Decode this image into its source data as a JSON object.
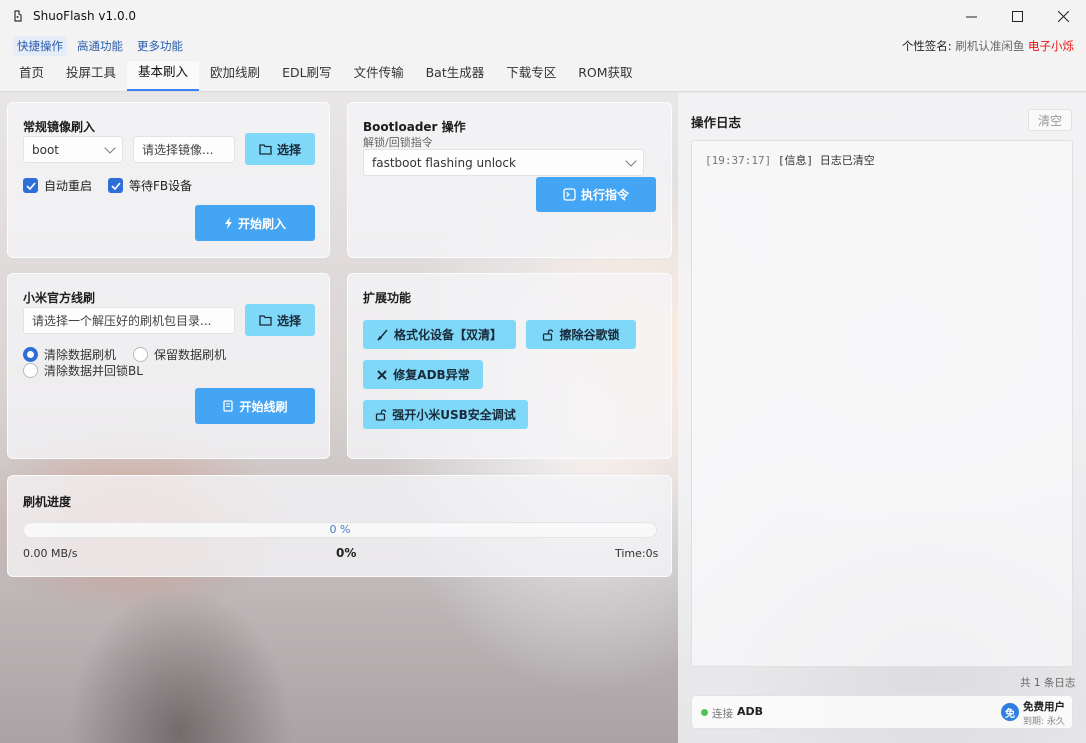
{
  "window": {
    "title": "ShuoFlash v1.0.0"
  },
  "menubar": {
    "items": [
      "快捷操作",
      "高通功能",
      "更多功能"
    ]
  },
  "signature": {
    "label": "个性签名:",
    "text": "刷机认准闲鱼",
    "highlight": "电子小烁"
  },
  "tabs": [
    "首页",
    "投屏工具",
    "基本刷入",
    "欧加线刷",
    "EDL刷写",
    "文件传输",
    "Bat生成器",
    "下载专区",
    "ROM获取"
  ],
  "active_tab": "基本刷入",
  "image_flash": {
    "title": "常规镜像刷入",
    "partition_value": "boot",
    "image_placeholder": "请选择镜像...",
    "select_label": "选择",
    "auto_reboot_label": "自动重启",
    "auto_reboot_checked": true,
    "wait_fb_label": "等待FB设备",
    "wait_fb_checked": true,
    "start_label": "开始刷入"
  },
  "bootloader": {
    "title": "Bootloader 操作",
    "subtitle": "解锁/回锁指令",
    "command_value": "fastboot flashing unlock",
    "execute_label": "执行指令"
  },
  "xiaomi_flash": {
    "title": "小米官方线刷",
    "dir_placeholder": "请选择一个解压好的刷机包目录...",
    "select_label": "选择",
    "options": [
      "清除数据刷机",
      "保留数据刷机",
      "清除数据并回锁BL"
    ],
    "selected_option": "清除数据刷机",
    "start_label": "开始线刷"
  },
  "extensions": {
    "title": "扩展功能",
    "buttons": [
      "格式化设备【双清】",
      "擦除谷歌锁",
      "修复ADB异常",
      "强开小米USB安全调试"
    ]
  },
  "progress": {
    "title": "刷机进度",
    "bar_text": "0 %",
    "value": 0,
    "speed": "0.00 MB/s",
    "percent": "0%",
    "time": "Time:0s"
  },
  "log": {
    "title": "操作日志",
    "clear_label": "清空",
    "lines": [
      {
        "time": "[19:37:17]",
        "text": "[信息] 日志已清空"
      }
    ],
    "count_text": "共 1 条日志"
  },
  "status": {
    "connection_prefix": "连接",
    "connection_mode": "ADB",
    "connection_color": "#4cc552",
    "user_badge": "免",
    "user_type": "免费用户",
    "expiry": "到期: 永久"
  },
  "colors": {
    "accent": "#3b82f6",
    "primary_button": "#45a5f5",
    "light_button": "#7fd8f7",
    "signature_highlight": "#e11111"
  }
}
